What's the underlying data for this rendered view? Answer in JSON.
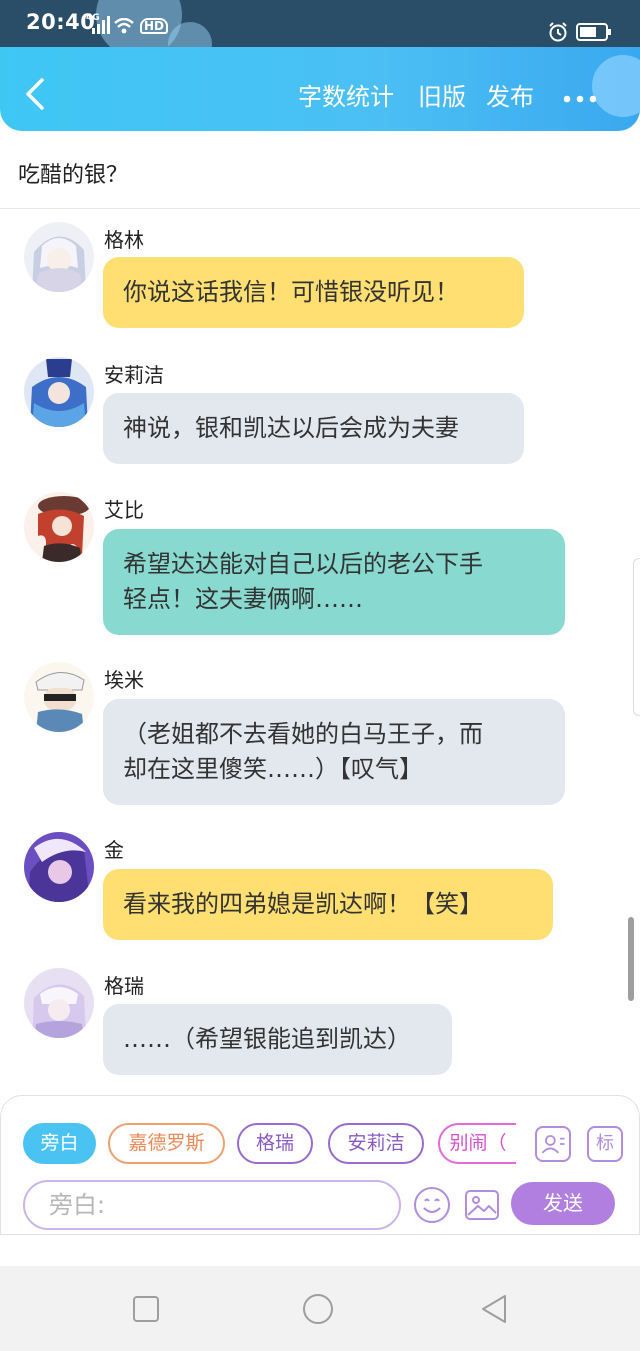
{
  "status_bar": {
    "time": "20:40",
    "network": "4G",
    "hd": "HD"
  },
  "header": {
    "nav": [
      "字数统计",
      "旧版",
      "发布"
    ]
  },
  "title": "吃醋的银？",
  "messages": [
    {
      "name": "格林",
      "text": [
        "你说这话我信！可惜银没听见！"
      ],
      "color": "yellow"
    },
    {
      "name": "安莉洁",
      "text": [
        "神说，银和凯达以后会成为夫妻"
      ],
      "color": "gray"
    },
    {
      "name": "艾比",
      "text": [
        "希望达达能对自己以后的老公下手",
        "轻点！这夫妻俩啊……"
      ],
      "color": "teal"
    },
    {
      "name": "埃米",
      "text": [
        "（老姐都不去看她的白马王子，而",
        "却在这里傻笑……）【叹气】"
      ],
      "color": "gray"
    },
    {
      "name": "金",
      "text": [
        "看来我的四弟媳是凯达啊！【笑】"
      ],
      "color": "yellow"
    },
    {
      "name": "格瑞",
      "text": [
        "……（希望银能追到凯达）"
      ],
      "color": "gray"
    }
  ],
  "composer": {
    "chips": [
      "旁白",
      "嘉德罗斯",
      "格瑞",
      "安莉洁",
      "别闹（"
    ],
    "tag_label": "标",
    "input_placeholder": "旁白:",
    "send_label": "发送"
  },
  "colors": {
    "header": "#3fc7f4",
    "yellow": "#ffdf72",
    "gray": "#e3e7ee",
    "teal": "#88d9cf",
    "accent": "#b07fe0",
    "narration_chip": "#4ac3f2",
    "orange_chip": "#f0a070"
  },
  "icons": [
    "back-arrow-icon",
    "more-dots-icon",
    "person-card-icon",
    "emoji-icon",
    "image-icon",
    "nav-square-icon",
    "nav-circle-icon",
    "nav-back-triangle-icon"
  ]
}
